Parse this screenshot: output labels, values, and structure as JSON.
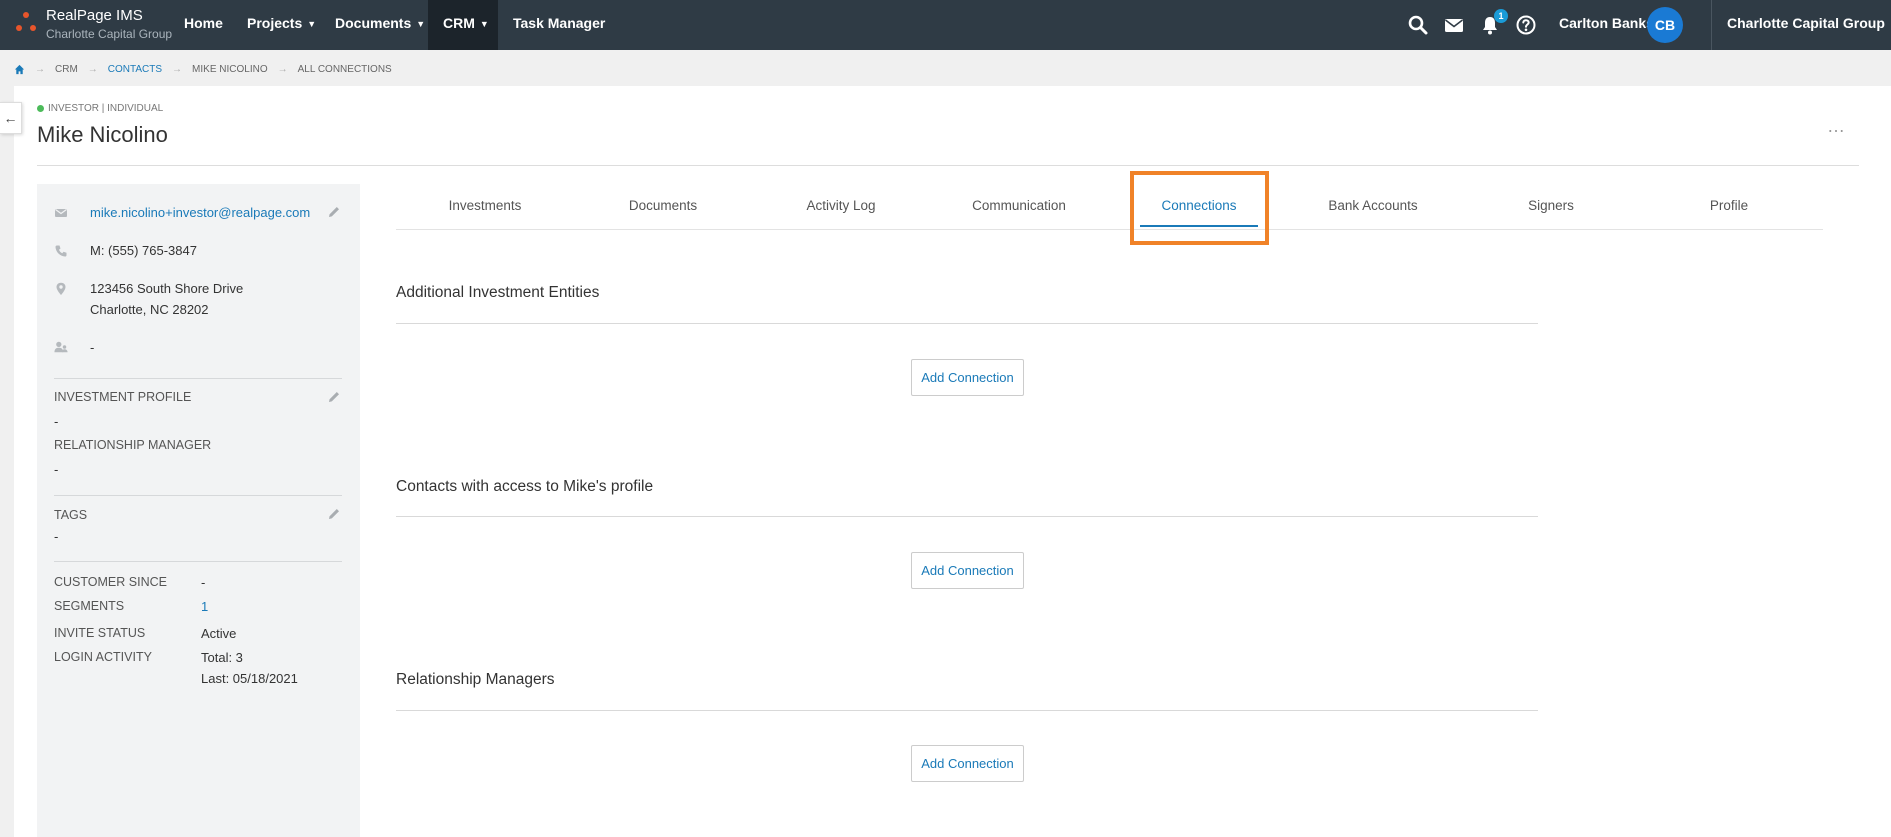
{
  "app": {
    "brand_title": "RealPage IMS",
    "brand_subtitle": "Charlotte Capital Group"
  },
  "topnav": {
    "items": [
      {
        "label": "Home",
        "has_caret": false
      },
      {
        "label": "Projects",
        "has_caret": true
      },
      {
        "label": "Documents",
        "has_caret": true
      },
      {
        "label": "CRM",
        "has_caret": true,
        "active": true
      },
      {
        "label": "Task Manager",
        "has_caret": false
      }
    ],
    "icons": [
      "search-icon",
      "mail-icon",
      "bell-icon",
      "help-icon"
    ],
    "notification_count": "1",
    "user_name": "Carlton Banks",
    "user_initials": "CB",
    "org_name": "Charlotte Capital Group"
  },
  "breadcrumb": [
    "CRM",
    "CONTACTS",
    "MIKE NICOLINO",
    "ALL CONNECTIONS"
  ],
  "contact": {
    "type_label": "INVESTOR | INDIVIDUAL",
    "name": "Mike Nicolino",
    "more": "…"
  },
  "sidebar": {
    "email": "mike.nicolino+investor@realpage.com",
    "phone": "M: (555) 765-3847",
    "address_line1": "123456 South Shore Drive",
    "address_line2": "Charlotte, NC 28202",
    "contact_person": "-",
    "investment_profile_label": "INVESTMENT PROFILE",
    "investment_profile_value": "-",
    "relationship_manager_label": "RELATIONSHIP MANAGER",
    "relationship_manager_value": "-",
    "tags_label": "TAGS",
    "tags_value": "-",
    "customer_since_label": "CUSTOMER SINCE",
    "customer_since_value": "-",
    "segments_label": "SEGMENTS",
    "segments_value": "1",
    "invite_status_label": "INVITE STATUS",
    "invite_status_value": "Active",
    "login_activity_label": "LOGIN ACTIVITY",
    "login_total": "Total: 3",
    "login_last": "Last: 05/18/2021"
  },
  "tabs": [
    {
      "label": "Investments"
    },
    {
      "label": "Documents"
    },
    {
      "label": "Activity Log"
    },
    {
      "label": "Communication"
    },
    {
      "label": "Connections",
      "active": true
    },
    {
      "label": "Bank Accounts"
    },
    {
      "label": "Signers"
    },
    {
      "label": "Profile"
    }
  ],
  "sections": [
    {
      "title": "Additional Investment Entities",
      "button": "Add Connection"
    },
    {
      "title": "Contacts with access to Mike's profile",
      "button": "Add Connection"
    },
    {
      "title": "Relationship Managers",
      "button": "Add Connection"
    }
  ],
  "colors": {
    "nav_bg": "#2f3b45",
    "accent": "#1a7ab8",
    "highlight": "#f08228",
    "status_active": "#4cbb5a"
  }
}
